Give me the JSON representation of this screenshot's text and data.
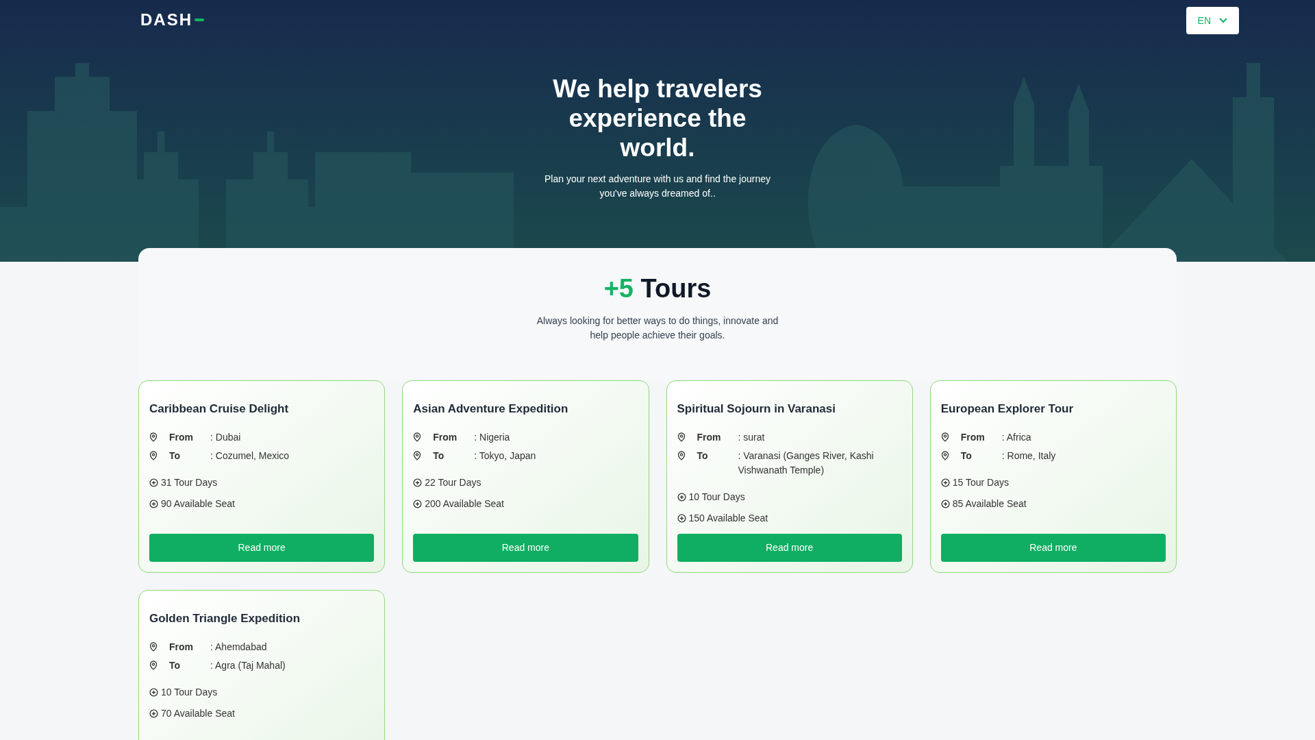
{
  "header": {
    "logo": "DASH",
    "language": "EN"
  },
  "hero": {
    "title": "We help travelers experience the world.",
    "subtitle": "Plan your next adventure with us and find the journey you've always dreamed of.."
  },
  "tours_section": {
    "count": "+5",
    "title": "Tours",
    "subtitle": "Always looking for better ways to do things, innovate and help people achieve their goals."
  },
  "tours": [
    {
      "name": "Caribbean Cruise Delight",
      "from_label": "From",
      "from": ": Dubai",
      "to_label": "To",
      "to": ": Cozumel, Mexico",
      "days": "31 Tour Days",
      "seats": "90 Available Seat",
      "button": "Read more"
    },
    {
      "name": "Asian Adventure Expedition",
      "from_label": "From",
      "from": ": Nigeria",
      "to_label": "To",
      "to": ": Tokyo, Japan",
      "days": "22 Tour Days",
      "seats": "200 Available Seat",
      "button": "Read more"
    },
    {
      "name": "Spiritual Sojourn in Varanasi",
      "from_label": "From",
      "from": ": surat",
      "to_label": "To",
      "to": ": Varanasi (Ganges River, Kashi Vishwanath Temple)",
      "days": "10 Tour Days",
      "seats": "150 Available Seat",
      "button": "Read more"
    },
    {
      "name": "European Explorer Tour",
      "from_label": "From",
      "from": ": Africa",
      "to_label": "To",
      "to": ": Rome, Italy",
      "days": "15 Tour Days",
      "seats": "85 Available Seat",
      "button": "Read more"
    },
    {
      "name": "Golden Triangle Expedition",
      "from_label": "From",
      "from": ": Ahemdabad",
      "to_label": "To",
      "to": ": Agra (Taj Mahal)",
      "days": "10 Tour Days",
      "seats": "70 Available Seat"
    }
  ]
}
